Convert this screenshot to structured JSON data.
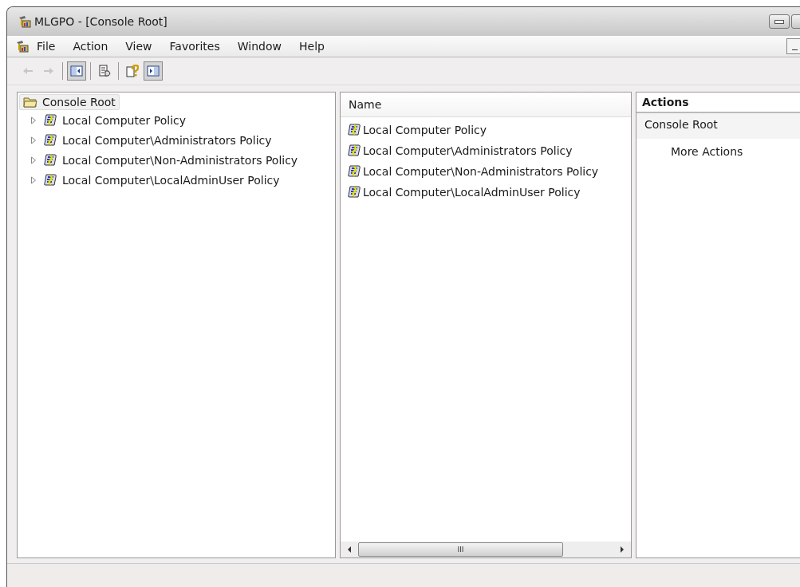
{
  "window": {
    "title": "MLGPO - [Console Root]"
  },
  "menu": [
    "File",
    "Action",
    "View",
    "Favorites",
    "Window",
    "Help"
  ],
  "toolbar": [
    {
      "kind": "back",
      "disabled": true,
      "pressed": false
    },
    {
      "kind": "forward",
      "disabled": true,
      "pressed": false
    },
    {
      "kind": "tree-toggle",
      "disabled": false,
      "pressed": true
    },
    {
      "kind": "export",
      "disabled": false,
      "pressed": false
    },
    {
      "kind": "help",
      "disabled": false,
      "pressed": false
    },
    {
      "kind": "action-toggle",
      "disabled": false,
      "pressed": true
    }
  ],
  "tree": {
    "root": {
      "label": "Console Root",
      "selected": true
    },
    "items": [
      {
        "label": "Local Computer Policy",
        "expanded": false
      },
      {
        "label": "Local Computer\\Administrators Policy",
        "expanded": false
      },
      {
        "label": "Local Computer\\Non-Administrators Policy",
        "expanded": false
      },
      {
        "label": "Local Computer\\LocalAdminUser Policy",
        "expanded": false
      }
    ]
  },
  "list": {
    "columns": [
      "Name"
    ],
    "rows": [
      "Local Computer Policy",
      "Local Computer\\Administrators Policy",
      "Local Computer\\Non-Administrators Policy",
      "Local Computer\\LocalAdminUser Policy"
    ],
    "scrollbar_glyph": "III"
  },
  "actions": {
    "title": "Actions",
    "section": "Console Root",
    "items": [
      "More Actions"
    ]
  }
}
